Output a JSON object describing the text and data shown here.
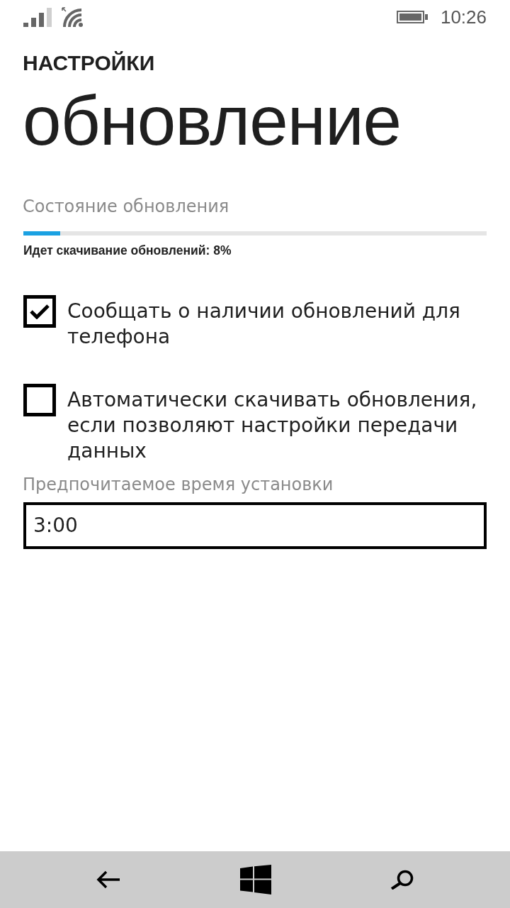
{
  "status_bar": {
    "time": "10:26"
  },
  "header": {
    "app_title": "НАСТРОЙКИ",
    "page_title": "обновление"
  },
  "update_status": {
    "label": "Состояние обновления",
    "progress": {
      "level": 0.08
    },
    "status_text": "Идет скачивание обновлений: 8%"
  },
  "options": [
    {
      "label": "Сообщать о наличии обновлений для телефона",
      "checked": true
    },
    {
      "label": "Автоматически скачивать обновления, если позволяют настройки передачи данных",
      "checked": false
    }
  ],
  "install_time": {
    "label": "Предпочитаемое время установки",
    "value": "3:00"
  }
}
